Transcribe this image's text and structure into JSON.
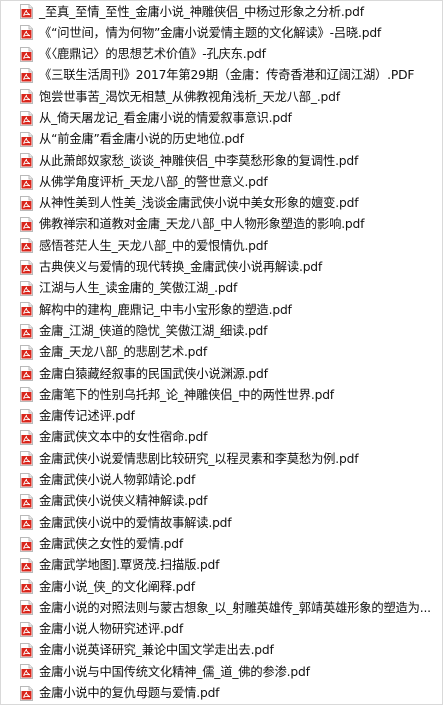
{
  "files": [
    {
      "name": "_至真_至情_至性_金庸小说_神雕侠侣_中杨过形象之分析.pdf",
      "icon": "pdf-icon"
    },
    {
      "name": "《“问世间，情为何物”金庸小说爱情主题的文化解读》-吕晓.pdf",
      "icon": "pdf-icon"
    },
    {
      "name": "《〈鹿鼎记〉的思想艺术价值》-孔庆东.pdf",
      "icon": "pdf-icon"
    },
    {
      "name": "《三联生活周刊》2017年第29期（金庸：传奇香港和辽阔江湖）.PDF",
      "icon": "pdf-icon"
    },
    {
      "name": "饱尝世事苦_渴饮无相慧_从佛教视角浅析_天龙八部_.pdf",
      "icon": "pdf-icon"
    },
    {
      "name": "从_倚天屠龙记_看金庸小说的情爱叙事意识.pdf",
      "icon": "pdf-icon"
    },
    {
      "name": "从“前金庸”看金庸小说的历史地位.pdf",
      "icon": "pdf-icon"
    },
    {
      "name": "从此萧郎奴家愁_谈谈_神雕侠侣_中李莫愁形象的复调性.pdf",
      "icon": "pdf-icon"
    },
    {
      "name": "从佛学角度评析_天龙八部_的警世意义.pdf",
      "icon": "pdf-icon"
    },
    {
      "name": "从神性美到人性美_浅谈金庸武侠小说中美女形象的嬗变.pdf",
      "icon": "pdf-icon"
    },
    {
      "name": "佛教禅宗和道教对金庸_天龙八部_中人物形象塑造的影响.pdf",
      "icon": "pdf-icon"
    },
    {
      "name": "感悟苍茫人生_天龙八部_中的爱恨情仇.pdf",
      "icon": "pdf-icon"
    },
    {
      "name": "古典侠义与爱情的现代转换_金庸武侠小说再解读.pdf",
      "icon": "pdf-icon"
    },
    {
      "name": "江湖与人生_读金庸的_笑傲江湖_.pdf",
      "icon": "pdf-icon"
    },
    {
      "name": "解构中的建构_鹿鼎记_中韦小宝形象的塑造.pdf",
      "icon": "pdf-icon"
    },
    {
      "name": "金庸_江湖_侠道的隐忧_笑傲江湖_细读.pdf",
      "icon": "pdf-icon"
    },
    {
      "name": "金庸_天龙八部_的悲剧艺术.pdf",
      "icon": "pdf-icon"
    },
    {
      "name": "金庸白猿藏经叙事的民国武侠小说渊源.pdf",
      "icon": "pdf-icon"
    },
    {
      "name": "金庸笔下的性别乌托邦_论_神雕侠侣_中的两性世界.pdf",
      "icon": "pdf-icon"
    },
    {
      "name": "金庸传记述评.pdf",
      "icon": "pdf-icon"
    },
    {
      "name": "金庸武侠文本中的女性宿命.pdf",
      "icon": "pdf-icon"
    },
    {
      "name": "金庸武侠小说爱情悲剧比较研究_以程灵素和李莫愁为例.pdf",
      "icon": "pdf-icon"
    },
    {
      "name": "金庸武侠小说人物郭靖论.pdf",
      "icon": "pdf-icon"
    },
    {
      "name": "金庸武侠小说侠义精神解读.pdf",
      "icon": "pdf-icon"
    },
    {
      "name": "金庸武侠小说中的爱情故事解读.pdf",
      "icon": "pdf-icon"
    },
    {
      "name": "金庸武侠之女性的爱情.pdf",
      "icon": "pdf-icon"
    },
    {
      "name": "金庸武学地图].覃贤茂.扫描版.pdf",
      "icon": "pdf-icon"
    },
    {
      "name": "金庸小说_侠_的文化阐释.pdf",
      "icon": "pdf-icon"
    },
    {
      "name": "金庸小说的对照法则与蒙古想象_以_射雕英雄传_郭靖英雄形象的塑造为...",
      "icon": "pdf-icon"
    },
    {
      "name": "金庸小说人物研究述评.pdf",
      "icon": "pdf-icon"
    },
    {
      "name": "金庸小说英译研究_兼论中国文学走出去.pdf",
      "icon": "pdf-icon"
    },
    {
      "name": "金庸小说与中国传统文化精神_儒_道_佛的参渗.pdf",
      "icon": "pdf-icon"
    },
    {
      "name": "金庸小说中的复仇母题与爱情.pdf",
      "icon": "pdf-icon"
    }
  ],
  "colors": {
    "pdf_red": "#d9261c",
    "text": "#111111",
    "border": "#d9d9d9"
  }
}
